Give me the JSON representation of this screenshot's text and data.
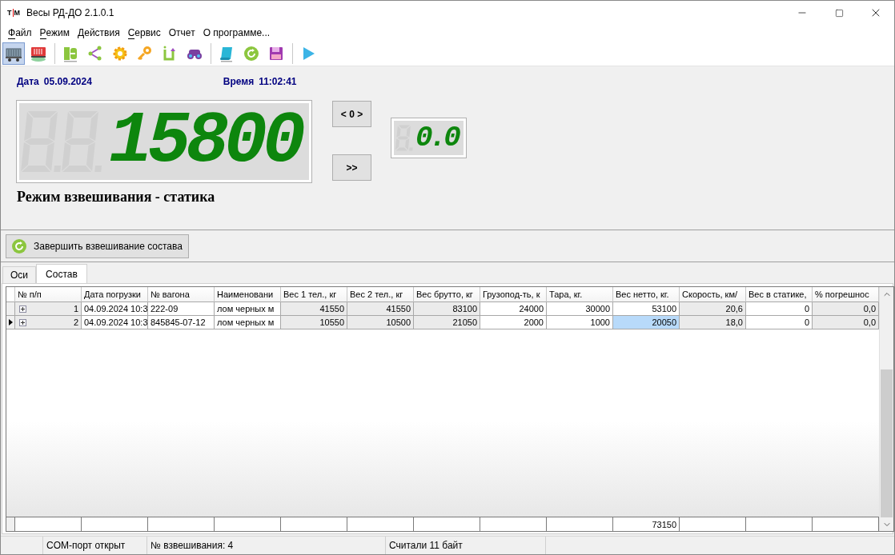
{
  "window": {
    "logo": {
      "left": "Т",
      "right": "М"
    },
    "title": "Весы РД-ДО 2.1.0.1"
  },
  "menu": [
    {
      "label": "Файл",
      "access_key": true
    },
    {
      "label": "Режим",
      "access_key": true
    },
    {
      "label": "Действия",
      "access_key": false
    },
    {
      "label": "Сервис",
      "access_key": true
    },
    {
      "label": "Отчет",
      "access_key": false
    },
    {
      "label": "О программе...",
      "access_key": false
    }
  ],
  "toolbar": [
    {
      "kind": "wagon",
      "selected": true
    },
    {
      "kind": "red-wagon",
      "selected": false
    },
    {
      "kind": "separator"
    },
    {
      "kind": "book",
      "selected": false
    },
    {
      "kind": "share",
      "selected": false
    },
    {
      "kind": "gear",
      "selected": false
    },
    {
      "kind": "key",
      "selected": false
    },
    {
      "kind": "return",
      "selected": false
    },
    {
      "kind": "binoculars",
      "selected": false
    },
    {
      "kind": "separator"
    },
    {
      "kind": "scroll",
      "selected": false
    },
    {
      "kind": "refresh",
      "selected": false
    },
    {
      "kind": "floppy",
      "selected": false
    },
    {
      "kind": "separator"
    },
    {
      "kind": "play",
      "selected": false
    }
  ],
  "info": {
    "date_label": "Дата",
    "date": "05.09.2024",
    "time_label": "Время",
    "time": "11:02:41"
  },
  "weight_display": {
    "value": "15800"
  },
  "zero_button": "< 0 >",
  "next_button": ">>",
  "speed_display": {
    "value": "0.0"
  },
  "mode_title": "Режим взвешивания - статика",
  "finish_button": "Завершить взвешивание состава",
  "tabs": [
    {
      "label": "Оси",
      "selected": false
    },
    {
      "label": "Состав",
      "selected": true
    }
  ],
  "table": {
    "columns": [
      "№ п/п",
      "Дата погрузки",
      "№ вагона",
      "Наименовани",
      "Вес 1 тел., кг",
      "Вес 2 тел., кг",
      "Вес брутто, кг",
      "Грузопод-ть, к",
      "Тара, кг.",
      "Вес нетто, кг.",
      "Скорость, км/",
      "Вес в статике,",
      "% погрешнос"
    ],
    "rows": [
      {
        "current": false,
        "expanded": false,
        "cells": [
          {
            "text": "1",
            "readonly": true,
            "selected": false
          },
          {
            "text": "04.09.2024 10:3",
            "readonly": false,
            "selected": false
          },
          {
            "text": "222-09",
            "readonly": false,
            "selected": false
          },
          {
            "text": "лом черных м",
            "readonly": false,
            "selected": false
          },
          {
            "text": "41550",
            "readonly": true,
            "selected": false
          },
          {
            "text": "41550",
            "readonly": true,
            "selected": false
          },
          {
            "text": "83100",
            "readonly": true,
            "selected": false
          },
          {
            "text": "24000",
            "readonly": false,
            "selected": false
          },
          {
            "text": "30000",
            "readonly": false,
            "selected": false
          },
          {
            "text": "53100",
            "readonly": false,
            "selected": false
          },
          {
            "text": "20,6",
            "readonly": true,
            "selected": false
          },
          {
            "text": "0",
            "readonly": false,
            "selected": false
          },
          {
            "text": "0,0",
            "readonly": true,
            "selected": false
          }
        ]
      },
      {
        "current": true,
        "expanded": false,
        "cells": [
          {
            "text": "2",
            "readonly": true,
            "selected": false
          },
          {
            "text": "04.09.2024 10:3",
            "readonly": false,
            "selected": false
          },
          {
            "text": "845845-07-12",
            "readonly": false,
            "selected": false
          },
          {
            "text": "лом черных м",
            "readonly": false,
            "selected": false
          },
          {
            "text": "10550",
            "readonly": true,
            "selected": false
          },
          {
            "text": "10500",
            "readonly": true,
            "selected": false
          },
          {
            "text": "21050",
            "readonly": true,
            "selected": false
          },
          {
            "text": "2000",
            "readonly": false,
            "selected": false
          },
          {
            "text": "1000",
            "readonly": false,
            "selected": false
          },
          {
            "text": "20050",
            "readonly": false,
            "selected": true
          },
          {
            "text": "18,0",
            "readonly": true,
            "selected": false
          },
          {
            "text": "0",
            "readonly": false,
            "selected": false
          },
          {
            "text": "0,0",
            "readonly": true,
            "selected": false
          }
        ]
      }
    ],
    "footer": [
      {
        "kind": "empty"
      },
      {
        "kind": "empty"
      },
      {
        "kind": "empty"
      },
      {
        "kind": "empty"
      },
      {
        "kind": "empty"
      },
      {
        "kind": "empty"
      },
      {
        "kind": "empty"
      },
      {
        "kind": "empty"
      },
      {
        "kind": "empty"
      },
      {
        "kind": "total",
        "text": "73150"
      },
      {
        "kind": "empty"
      },
      {
        "kind": "empty"
      },
      {
        "kind": "empty"
      }
    ]
  },
  "status_bar": [
    "COM-порт открыт",
    "№ взвешивания: 4",
    "Считали 11 байт"
  ]
}
